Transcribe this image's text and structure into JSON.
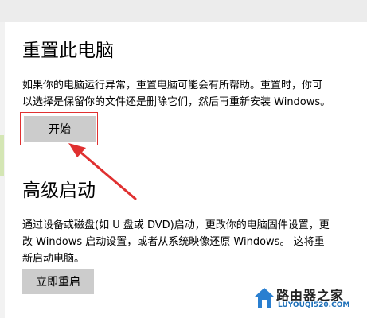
{
  "reset": {
    "title": "重置此电脑",
    "description_line1": "如果你的电脑运行异常，重置电脑可能会有所帮助。重置时，你可",
    "description_line2": "以选择是保留你的文件还是删除它们，然后再重新安装 Windows。",
    "button_label": "开始"
  },
  "advanced": {
    "title": "高级启动",
    "description_line1": "通过设备或磁盘(如 U 盘或 DVD)启动，更改你的电脑固件设置，更",
    "description_line2": "改 Windows 启动设置，或者从系统映像还原 Windows。 这将重",
    "description_line3": "新启动电脑。",
    "button_label": "立即重启"
  },
  "watermark": {
    "site_name": "路由器之家",
    "url": "LUYOUQI520.COM"
  },
  "colors": {
    "annotation": "#e03030",
    "button_bg": "#cccccc",
    "watermark_url": "#1d6fb8"
  }
}
